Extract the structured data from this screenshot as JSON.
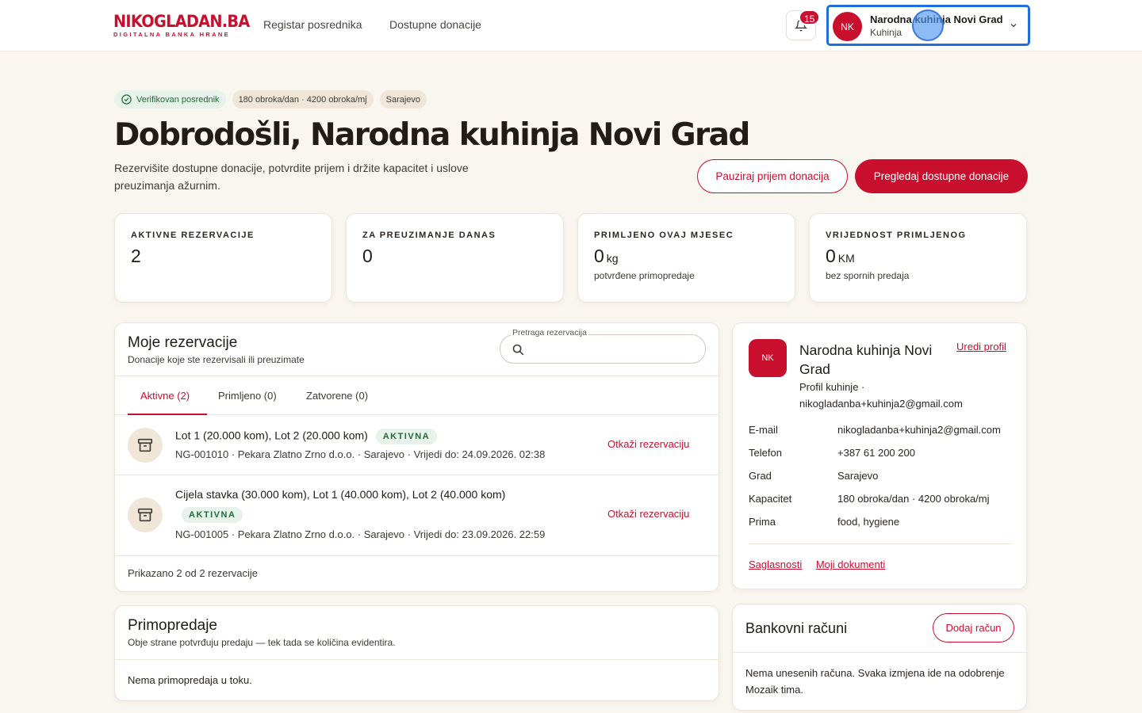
{
  "header": {
    "logo_main": "NIKOGLADAN.BA",
    "logo_sub": "DIGITALNA BANKA HRANE",
    "nav": [
      "Registar posrednika",
      "Dostupne donacije"
    ],
    "notifications_count": "15",
    "account": {
      "initials": "NK",
      "name": "Narodna kuhinja Novi Grad",
      "role": "Kuhinja"
    }
  },
  "hero": {
    "chips": [
      "Verifikovan posrednik",
      "180 obroka/dan · 4200 obroka/mj",
      "Sarajevo"
    ],
    "title": "Dobrodošli, Narodna kuhinja Novi Grad",
    "subtitle": "Rezervišite dostupne donacije, potvrdite prijem i držite kapacitet i uslove preuzimanja ažurnim.",
    "pause_button": "Pauziraj prijem donacija",
    "browse_button": "Pregledaj dostupne donacije"
  },
  "stats": [
    {
      "label": "AKTIVNE REZERVACIJE",
      "value": "2",
      "unit": "",
      "note": ""
    },
    {
      "label": "ZA PREUZIMANJE DANAS",
      "value": "0",
      "unit": "",
      "note": ""
    },
    {
      "label": "PRIMLJENO OVAJ MJESEC",
      "value": "0",
      "unit": "kg",
      "note": "potvrđene primopredaje"
    },
    {
      "label": "VRIJEDNOST PRIMLJENOG",
      "value": "0",
      "unit": "KM",
      "note": "bez spornih predaja"
    }
  ],
  "reservations": {
    "title": "Moje rezervacije",
    "subtitle": "Donacije koje ste rezervisali ili preuzimate",
    "search_label": "Pretraga rezervacija",
    "search_placeholder": "",
    "tabs": [
      "Aktivne (2)",
      "Primljeno (0)",
      "Zatvorene (0)"
    ],
    "active_tab": "Aktivne (2)",
    "rows": [
      {
        "title": "Lot 1 (20.000 kom), Lot 2 (20.000 kom)",
        "status": "AKTIVNA",
        "meta": "NG-001010 · Pekara Zlatno Zrno d.o.o. · Sarajevo · Vrijedi do: 24.09.2026. 02:38",
        "action": "Otkaži rezervaciju"
      },
      {
        "title": "Cijela stavka (30.000 kom), Lot 1 (40.000 kom), Lot 2 (40.000 kom)",
        "status": "AKTIVNA",
        "meta": "NG-001005 · Pekara Zlatno Zrno d.o.o. · Sarajevo · Vrijedi do: 23.09.2026. 22:59",
        "action": "Otkaži rezervaciju"
      }
    ],
    "footer": "Prikazano 2 od 2 rezervacije"
  },
  "profile": {
    "initials": "NK",
    "name": "Narodna kuhinja Novi Grad",
    "edit_link": "Uredi profil",
    "subtitle": "Profil kuhinje · nikogladanba+kuhinja2@gmail.com",
    "fields": [
      {
        "key": "E-mail",
        "value": "nikogladanba+kuhinja2@gmail.com"
      },
      {
        "key": "Telefon",
        "value": "+387 61 200 200"
      },
      {
        "key": "Grad",
        "value": "Sarajevo"
      },
      {
        "key": "Kapacitet",
        "value": "180 obroka/dan · 4200 obroka/mj"
      },
      {
        "key": "Prima",
        "value": "food, hygiene"
      }
    ],
    "links": [
      "Saglasnosti",
      "Moji dokumenti"
    ]
  },
  "handovers": {
    "title": "Primopredaje",
    "subtitle": "Obje strane potvrđuju predaju — tek tada se količina evidentira.",
    "empty": "Nema primopredaja u toku."
  },
  "bank": {
    "title": "Bankovni računi",
    "add_button": "Dodaj račun",
    "empty": "Nema unesenih računa. Svaka izmjena ide na odobrenje Mozaik tima."
  },
  "colors": {
    "brand": "#c8102e",
    "success": "#1e6b3a",
    "background": "#f9f5ef",
    "focus": "#1e6fd9"
  }
}
